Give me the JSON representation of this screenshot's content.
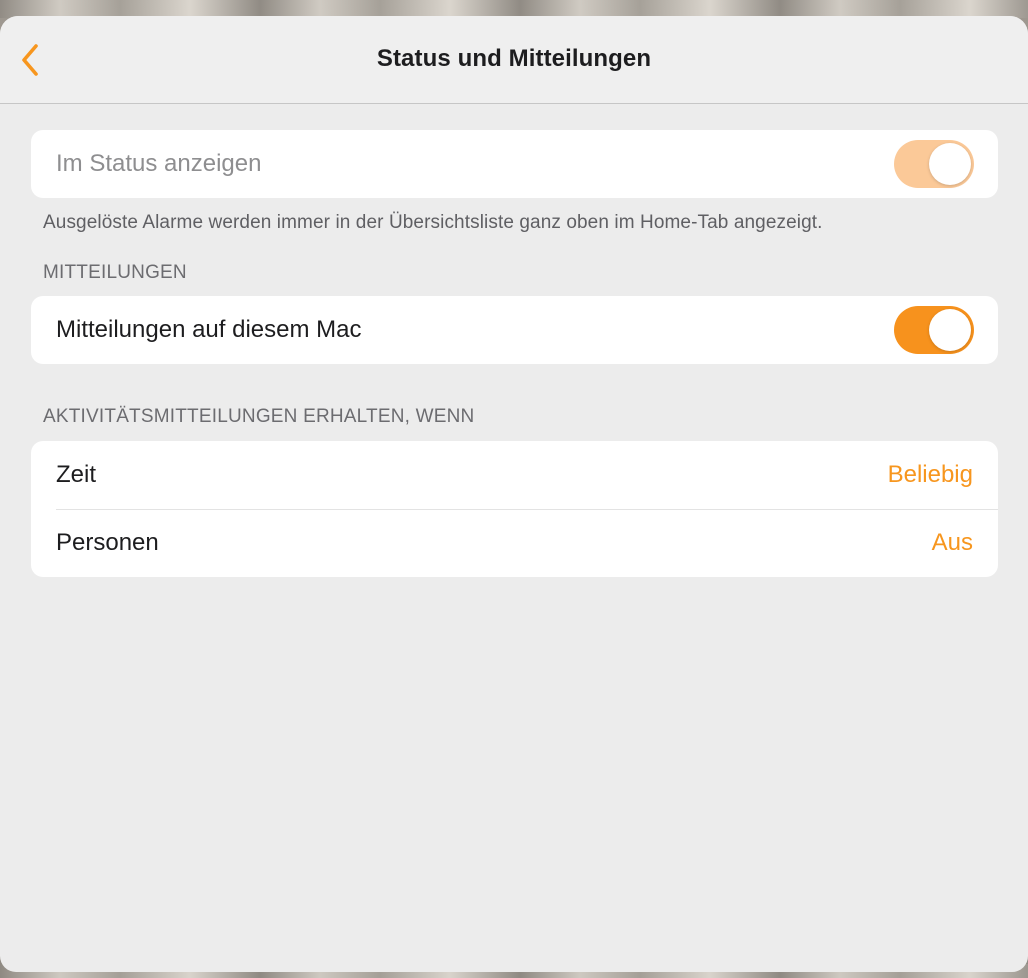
{
  "header": {
    "title": "Status und Mitteilungen",
    "back_icon": "chevron-left-icon"
  },
  "status_section": {
    "row_label": "Im Status anzeigen",
    "toggle_on": true,
    "toggle_enabled": false,
    "footnote": "Ausgelöste Alarme werden immer in der Übersichtsliste ganz oben im Home-Tab angezeigt."
  },
  "notifications_section": {
    "header": "MITTEILUNGEN",
    "row_label": "Mitteilungen auf diesem Mac",
    "toggle_on": true
  },
  "activity_section": {
    "header": "AKTIVITÄTSMITTEILUNGEN ERHALTEN, WENN",
    "rows": [
      {
        "label": "Zeit",
        "value": "Beliebig"
      },
      {
        "label": "Personen",
        "value": "Aus"
      }
    ]
  },
  "colors": {
    "accent": "#F7961E",
    "toggle_on": "#F7921D",
    "toggle_disabled": "#FBC998",
    "background": "#ECECEC"
  }
}
